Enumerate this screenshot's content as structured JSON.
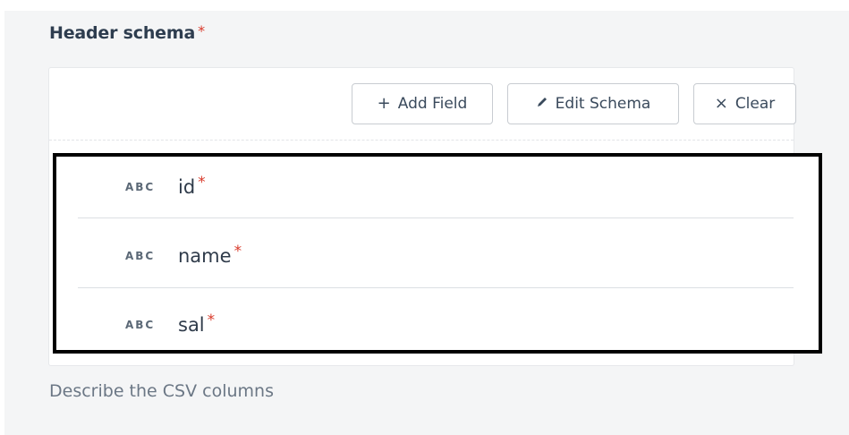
{
  "section": {
    "title": "Header schema",
    "required_mark": "*",
    "help_text": "Describe the CSV columns"
  },
  "toolbar": {
    "add_field": {
      "icon": "plus-icon",
      "glyph": "+",
      "label": "Add Field"
    },
    "edit_schema": {
      "icon": "pencil-icon",
      "glyph": "✎",
      "label": "Edit Schema"
    },
    "clear": {
      "icon": "close-icon",
      "glyph": "×",
      "label": "Clear"
    }
  },
  "fields": [
    {
      "type": "ABC",
      "name": "id",
      "required_mark": "*"
    },
    {
      "type": "ABC",
      "name": "name",
      "required_mark": "*"
    },
    {
      "type": "ABC",
      "name": "sal",
      "required_mark": "*"
    }
  ],
  "colors": {
    "panel_bg": "#f4f5f6",
    "required": "#d93a2b",
    "text_dark": "#2e3d4f",
    "help_text": "#6b7785",
    "highlight_border": "#000000"
  }
}
